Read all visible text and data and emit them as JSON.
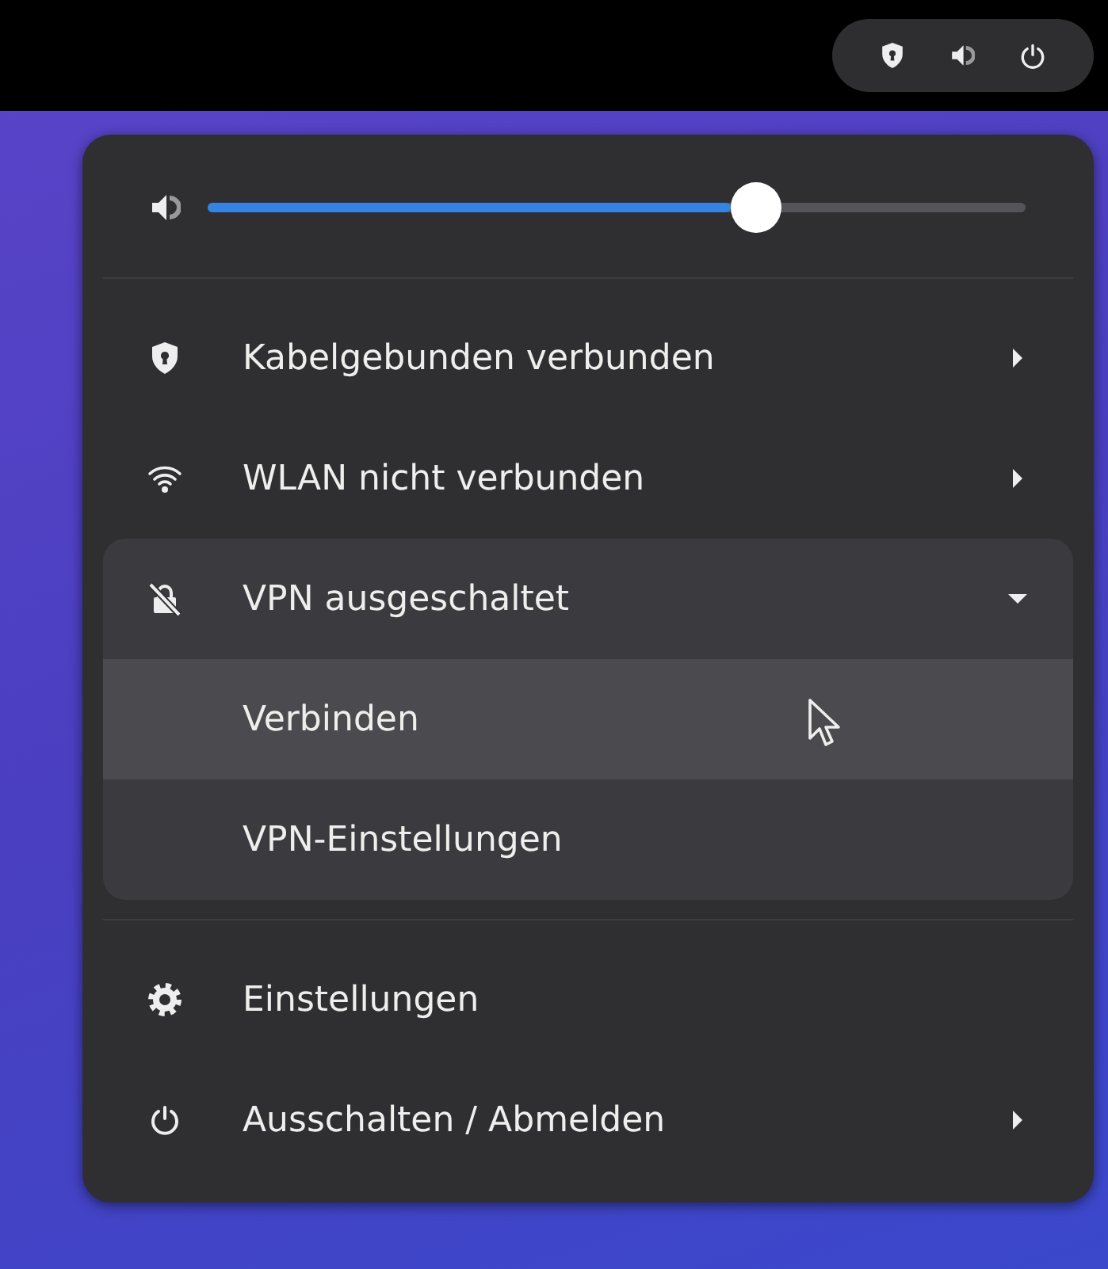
{
  "volume": {
    "level": 0.67
  },
  "network_items": [
    {
      "label": "Kabelgebunden verbunden",
      "kind": "submenu"
    },
    {
      "label": "WLAN nicht verbunden",
      "kind": "submenu"
    },
    {
      "label": "VPN ausgeschaltet",
      "kind": "expander",
      "expanded": true,
      "children": [
        {
          "label": "Verbinden",
          "selected": true
        },
        {
          "label": "VPN-Einstellungen",
          "selected": false
        }
      ]
    }
  ],
  "system_items": [
    {
      "label": "Einstellungen",
      "kind": "action"
    },
    {
      "label": "Ausschalten / Abmelden",
      "kind": "submenu"
    }
  ]
}
